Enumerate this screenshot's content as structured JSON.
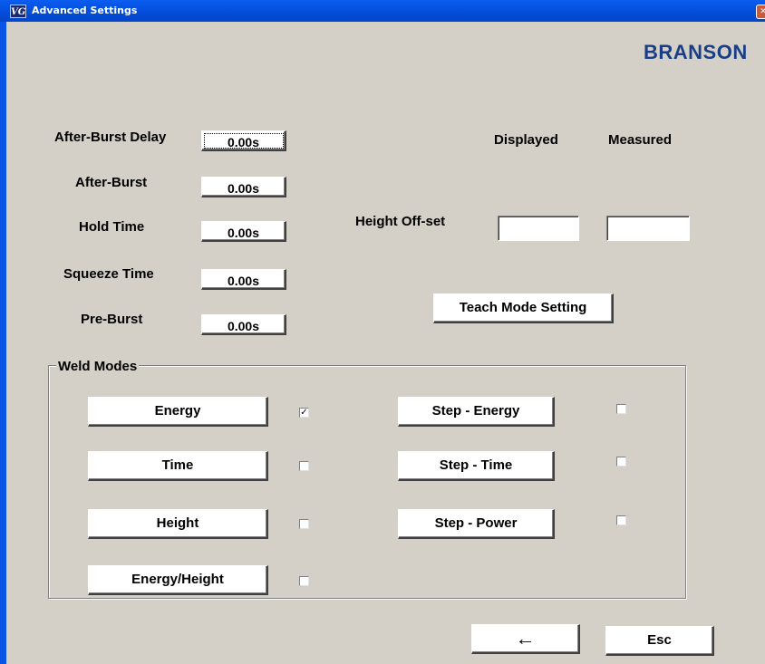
{
  "window": {
    "title": "Advanced Settings",
    "app_icon_text": "VG"
  },
  "brand": {
    "logo": "BRANSON"
  },
  "timings": [
    {
      "label": "After-Burst Delay",
      "value": "0.00s"
    },
    {
      "label": "After-Burst",
      "value": "0.00s"
    },
    {
      "label": "Hold Time",
      "value": "0.00s"
    },
    {
      "label": "Squeeze Time",
      "value": "0.00s"
    },
    {
      "label": "Pre-Burst",
      "value": "0.00s"
    }
  ],
  "height_offset": {
    "label": "Height Off-set",
    "displayed_header": "Displayed",
    "measured_header": "Measured",
    "displayed_value": "",
    "measured_value": ""
  },
  "teach_mode_button": "Teach Mode Setting",
  "weld_modes": {
    "title": "Weld Modes",
    "modes": [
      {
        "label": "Energy",
        "checked": true
      },
      {
        "label": "Time",
        "checked": false
      },
      {
        "label": "Height",
        "checked": false
      },
      {
        "label": "Energy/Height",
        "checked": false
      },
      {
        "label": "Step - Energy",
        "checked": false
      },
      {
        "label": "Step - Time",
        "checked": false
      },
      {
        "label": "Step - Power",
        "checked": false
      }
    ]
  },
  "footer": {
    "enter_symbol": "←",
    "esc_label": "Esc"
  },
  "colors": {
    "titlebar": "#0550e0",
    "background": "#d4d0c8",
    "logo": "#1a3e86"
  }
}
